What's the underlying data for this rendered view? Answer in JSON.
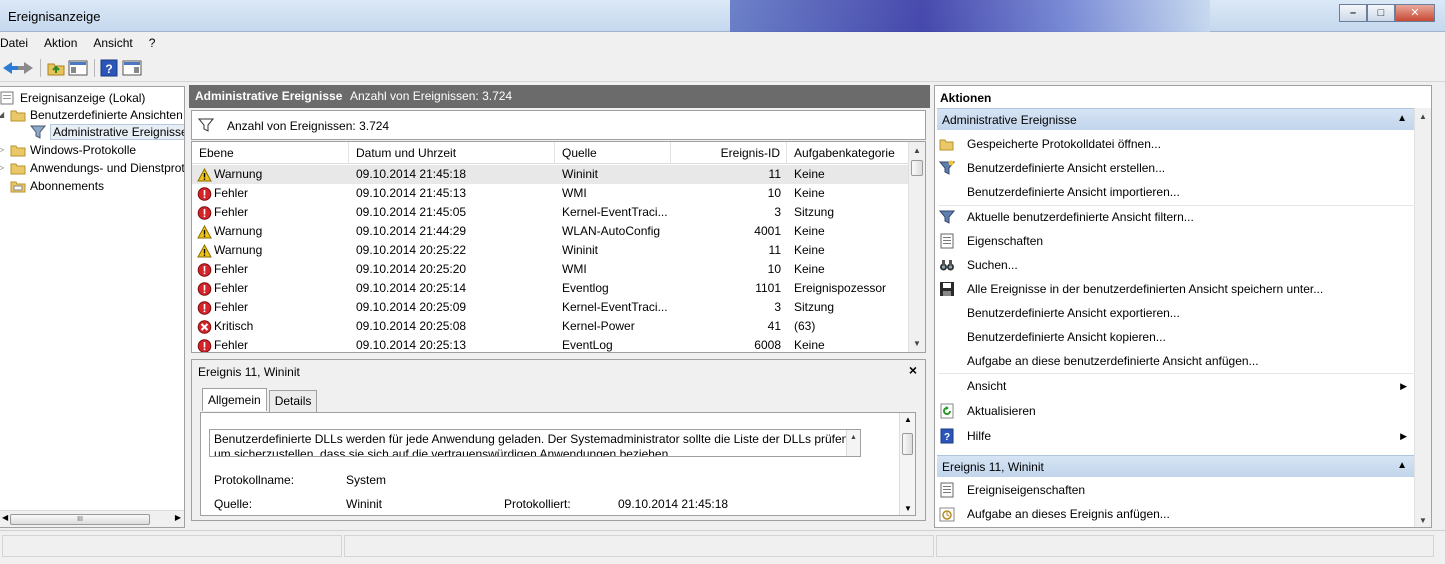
{
  "window": {
    "title": "Ereignisanzeige"
  },
  "menu": [
    "Datei",
    "Aktion",
    "Ansicht",
    "?"
  ],
  "tree": {
    "items": [
      {
        "label": "Ereignisanzeige (Lokal)",
        "icon": "event-viewer-icon"
      },
      {
        "label": "Benutzerdefinierte Ansichten",
        "icon": "folder-icon"
      },
      {
        "label": "Administrative Ereignisse",
        "icon": "filter-icon"
      },
      {
        "label": "Windows-Protokolle",
        "icon": "folder-icon"
      },
      {
        "label": "Anwendungs- und Dienstprotokolle",
        "icon": "folder-icon"
      },
      {
        "label": "Abonnements",
        "icon": "subscription-icon"
      }
    ],
    "scrollbar_grip": "III"
  },
  "center": {
    "title": "Administrative Ereignisse",
    "count_label": "Anzahl von Ereignissen: 3.724",
    "filter_count_label": "Anzahl von Ereignissen: 3.724",
    "columns": [
      "Ebene",
      "Datum und Uhrzeit",
      "Quelle",
      "Ereignis-ID",
      "Aufgabenkategorie"
    ],
    "rows": [
      {
        "level": "Warnung",
        "date": "09.10.2014 21:45:18",
        "source": "Wininit",
        "id": "11",
        "category": "Keine"
      },
      {
        "level": "Fehler",
        "date": "09.10.2014 21:45:13",
        "source": "WMI",
        "id": "10",
        "category": "Keine"
      },
      {
        "level": "Fehler",
        "date": "09.10.2014 21:45:05",
        "source": "Kernel-EventTraci...",
        "id": "3",
        "category": "Sitzung"
      },
      {
        "level": "Warnung",
        "date": "09.10.2014 21:44:29",
        "source": "WLAN-AutoConfig",
        "id": "4001",
        "category": "Keine"
      },
      {
        "level": "Warnung",
        "date": "09.10.2014 20:25:22",
        "source": "Wininit",
        "id": "11",
        "category": "Keine"
      },
      {
        "level": "Fehler",
        "date": "09.10.2014 20:25:20",
        "source": "WMI",
        "id": "10",
        "category": "Keine"
      },
      {
        "level": "Fehler",
        "date": "09.10.2014 20:25:14",
        "source": "Eventlog",
        "id": "1101",
        "category": "Ereignispozessor"
      },
      {
        "level": "Fehler",
        "date": "09.10.2014 20:25:09",
        "source": "Kernel-EventTraci...",
        "id": "3",
        "category": "Sitzung"
      },
      {
        "level": "Kritisch",
        "date": "09.10.2014 20:25:08",
        "source": "Kernel-Power",
        "id": "41",
        "category": "(63)"
      },
      {
        "level": "Fehler",
        "date": "09.10.2014 20:25:13",
        "source": "EventLog",
        "id": "6008",
        "category": "Keine"
      }
    ]
  },
  "detail": {
    "title": "Ereignis 11, Wininit",
    "close": "×",
    "tabs": [
      "Allgemein",
      "Details"
    ],
    "description_line1": "Benutzerdefinierte DLLs werden für jede Anwendung geladen. Der Systemadministrator sollte die Liste der DLLs prüfen,",
    "description_line2": "um sicherzustellen, dass sie sich auf die vertrauenswürdigen Anwendungen beziehen.",
    "log_name_label": "Protokollname:",
    "log_name_value": "System",
    "source_label": "Quelle:",
    "source_value": "Wininit",
    "logged_label": "Protokolliert:",
    "logged_value": "09.10.2014 21:45:18"
  },
  "actions": {
    "title": "Aktionen",
    "section1": "Administrative Ereignisse",
    "items1": [
      {
        "label": "Gespeicherte Protokolldatei öffnen...",
        "icon": "open-folder-icon"
      },
      {
        "label": "Benutzerdefinierte Ansicht erstellen...",
        "icon": "filter-create-icon"
      },
      {
        "label": "Benutzerdefinierte Ansicht importieren...",
        "icon": ""
      },
      {
        "label": "Aktuelle benutzerdefinierte Ansicht filtern...",
        "icon": "filter-icon"
      },
      {
        "label": "Eigenschaften",
        "icon": "properties-icon"
      },
      {
        "label": "Suchen...",
        "icon": "binoculars-icon"
      },
      {
        "label": "Alle Ereignisse in der benutzerdefinierten Ansicht speichern unter...",
        "icon": "save-icon"
      },
      {
        "label": "Benutzerdefinierte Ansicht exportieren...",
        "icon": ""
      },
      {
        "label": "Benutzerdefinierte Ansicht kopieren...",
        "icon": ""
      },
      {
        "label": "Aufgabe an diese benutzerdefinierte Ansicht anfügen...",
        "icon": ""
      },
      {
        "label": "Ansicht",
        "icon": ""
      },
      {
        "label": "Aktualisieren",
        "icon": "refresh-icon"
      },
      {
        "label": "Hilfe",
        "icon": "help-icon"
      }
    ],
    "section2": "Ereignis 11, Wininit",
    "items2": [
      {
        "label": "Ereigniseigenschaften",
        "icon": "properties-icon"
      },
      {
        "label": "Aufgabe an dieses Ereignis anfügen...",
        "icon": "task-icon"
      }
    ]
  },
  "colors": {
    "warning": "#f0c419",
    "error": "#d4242a",
    "header_bg": "#6b6b6b",
    "section_bg": "#c9dbef"
  }
}
